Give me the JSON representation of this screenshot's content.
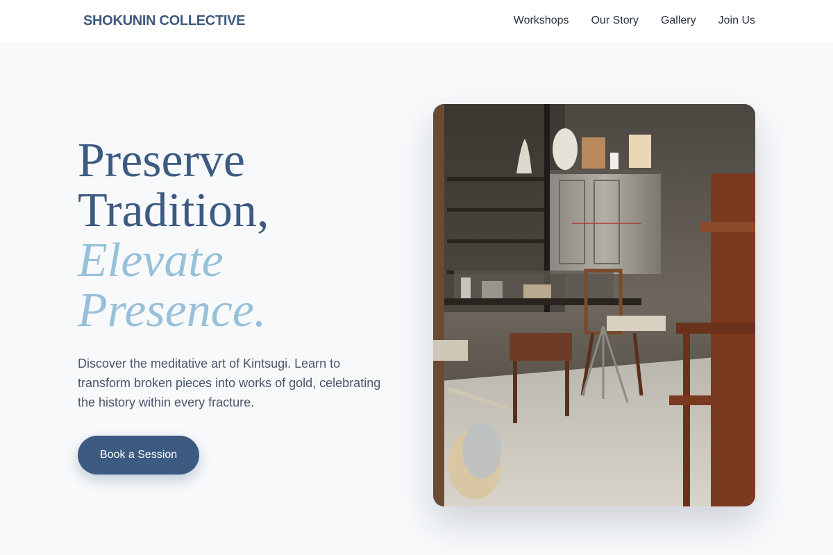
{
  "header": {
    "logo": "SHOKUNIN COLLECTIVE",
    "nav": [
      {
        "label": "Workshops"
      },
      {
        "label": "Our Story"
      },
      {
        "label": "Gallery"
      },
      {
        "label": "Join Us"
      }
    ]
  },
  "hero": {
    "headline": {
      "line1": "Preserve",
      "line2": "Tradition,",
      "line3": "Elevate",
      "line4": "Presence."
    },
    "description": "Discover the meditative art of Kintsugi. Learn to transform broken pieces into works of gold, celebrating the history within every fracture.",
    "cta_label": "Book a Session"
  },
  "colors": {
    "primary": "#3d5a80",
    "accent": "#98c1d9",
    "background": "#f7f9fb",
    "text": "#4a5568"
  },
  "image": {
    "alt": "Craft workshop interior"
  }
}
